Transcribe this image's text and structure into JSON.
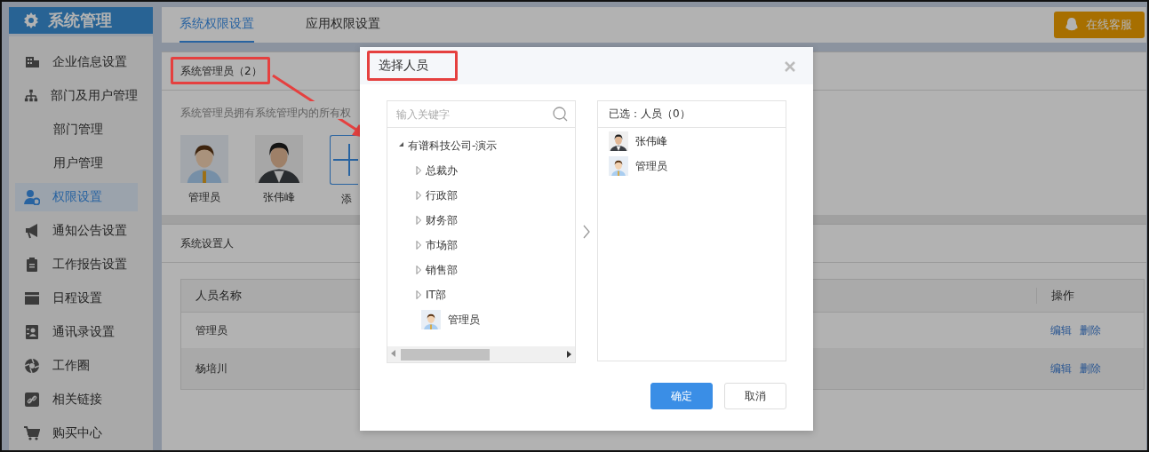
{
  "sidebar": {
    "title": "系统管理",
    "items": [
      {
        "label": "企业信息设置",
        "selected": false
      },
      {
        "label": "部门及用户管理",
        "selected": false,
        "children": [
          {
            "label": "部门管理",
            "selected": false
          },
          {
            "label": "用户管理",
            "selected": false
          }
        ]
      },
      {
        "label": "权限设置",
        "selected": true
      },
      {
        "label": "通知公告设置",
        "selected": false
      },
      {
        "label": "工作报告设置",
        "selected": false
      },
      {
        "label": "日程设置",
        "selected": false
      },
      {
        "label": "通讯录设置",
        "selected": false
      },
      {
        "label": "工作圈",
        "selected": false
      },
      {
        "label": "相关链接",
        "selected": false
      },
      {
        "label": "购买中心",
        "selected": false
      }
    ]
  },
  "tabs": [
    {
      "label": "系统权限设置",
      "selected": true
    },
    {
      "label": "应用权限设置",
      "selected": false
    }
  ],
  "support_button": "在线客服",
  "admins": {
    "title": "系统管理员（2）",
    "description": "系统管理员拥有系统管理内的所有权",
    "members": [
      {
        "name": "管理员",
        "kind": "default"
      },
      {
        "name": "张伟峰",
        "kind": "photo"
      }
    ],
    "add_label": "添"
  },
  "setters": {
    "title": "系统设置人",
    "table": {
      "columns": [
        "人员名称",
        "操作"
      ],
      "rows": [
        {
          "name": "管理员",
          "actions": [
            "编辑",
            "删除"
          ]
        },
        {
          "name": "杨培川",
          "actions": [
            "编辑",
            "删除"
          ]
        }
      ]
    }
  },
  "dialog": {
    "title": "选择人员",
    "search": {
      "placeholder": "输入关键字"
    },
    "tree": [
      {
        "label": "有谱科技公司-演示",
        "expanded": true,
        "children": [
          {
            "label": "总裁办",
            "expanded": false
          },
          {
            "label": "行政部",
            "expanded": false
          },
          {
            "label": "财务部",
            "expanded": false
          },
          {
            "label": "市场部",
            "expanded": false
          },
          {
            "label": "销售部",
            "expanded": false
          },
          {
            "label": "IT部",
            "expanded": false
          },
          {
            "label": "管理员",
            "kind": "person"
          }
        ]
      }
    ],
    "selected_header": "已选：人员（0）",
    "selected_people": [
      {
        "name": "张伟峰",
        "kind": "photo"
      },
      {
        "name": "管理员",
        "kind": "default"
      }
    ],
    "buttons": [
      {
        "label": "确定",
        "kind": "primary"
      },
      {
        "label": "取消",
        "kind": "secondary"
      }
    ]
  }
}
